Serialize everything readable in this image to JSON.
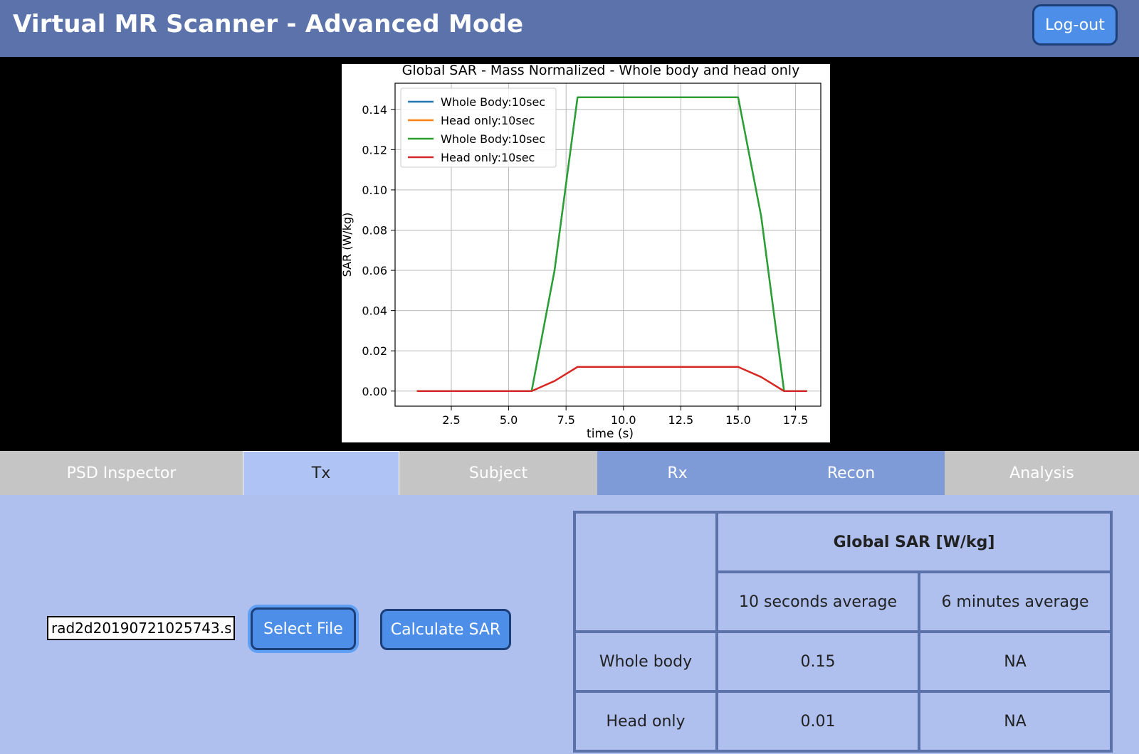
{
  "app": {
    "title": "Virtual MR Scanner - Advanced Mode",
    "logout_label": "Log-out"
  },
  "tabs": [
    "PSD Inspector",
    "Tx",
    "Subject",
    "Rx",
    "Recon",
    "Analysis"
  ],
  "tx_panel": {
    "file_value": "rad2d20190721025743.s",
    "select_file_label": "Select File",
    "calculate_label": "Calculate SAR"
  },
  "sar_table": {
    "header": "Global SAR [W/kg]",
    "col_10s": "10 seconds average",
    "col_6min": "6 minutes average",
    "rows": [
      {
        "label": "Whole body",
        "avg_10s": "0.15",
        "avg_6min": "NA"
      },
      {
        "label": "Head only",
        "avg_10s": "0.01",
        "avg_6min": "NA"
      }
    ]
  },
  "chart_data": {
    "type": "line",
    "title": "Global SAR  - Mass Normalized -  Whole body and head only",
    "xlabel": "time (s)",
    "ylabel": "SAR (W/kg)",
    "xlim": [
      0.05,
      18.6
    ],
    "ylim": [
      -0.0075,
      0.153
    ],
    "xticks": [
      "2.5",
      "5.0",
      "7.5",
      "10.0",
      "12.5",
      "15.0",
      "17.5"
    ],
    "xtick_values": [
      2.5,
      5.0,
      7.5,
      10.0,
      12.5,
      15.0,
      17.5
    ],
    "yticks": [
      "0.00",
      "0.02",
      "0.04",
      "0.06",
      "0.08",
      "0.10",
      "0.12",
      "0.14"
    ],
    "ytick_values": [
      0,
      0.02,
      0.04,
      0.06,
      0.08,
      0.1,
      0.12,
      0.14
    ],
    "grid": true,
    "legend_position": "upper left",
    "series": [
      {
        "name": "Whole Body:10sec",
        "color": "#1f77b4",
        "x": [
          1,
          6,
          7,
          8,
          15,
          16,
          17,
          18
        ],
        "y": [
          0,
          0,
          0.06,
          0.146,
          0.146,
          0.087,
          0,
          0
        ]
      },
      {
        "name": "Head only:10sec",
        "color": "#ff7f0e",
        "x": [
          1,
          6,
          7,
          8,
          15,
          16,
          17,
          18
        ],
        "y": [
          0,
          0,
          0.005,
          0.012,
          0.012,
          0.007,
          0,
          0
        ]
      },
      {
        "name": "Whole Body:10sec",
        "color": "#2ca02c",
        "x": [
          1,
          6,
          7,
          8,
          15,
          16,
          17,
          18
        ],
        "y": [
          0,
          0,
          0.06,
          0.146,
          0.146,
          0.087,
          0,
          0
        ]
      },
      {
        "name": "Head only:10sec",
        "color": "#d62728",
        "x": [
          1,
          6,
          7,
          8,
          15,
          16,
          17,
          18
        ],
        "y": [
          0,
          0,
          0.005,
          0.012,
          0.012,
          0.007,
          0,
          0
        ]
      }
    ]
  }
}
